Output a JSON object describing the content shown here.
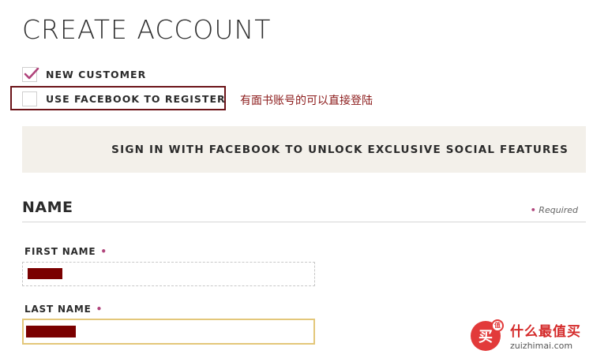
{
  "page_title": "CREATE ACCOUNT",
  "options": {
    "new_customer": {
      "label": "NEW CUSTOMER",
      "checked": true
    },
    "use_facebook": {
      "label": "USE FACEBOOK TO REGISTER",
      "checked": false
    }
  },
  "annotation_text": "有面书账号的可以直接登陆",
  "facebook_banner": "SIGN IN WITH FACEBOOK TO UNLOCK EXCLUSIVE SOCIAL FEATURES",
  "name_section": {
    "title": "NAME",
    "required_marker": "•",
    "required_label": "Required",
    "first_name_label": "FIRST NAME",
    "last_name_label": "LAST NAME"
  },
  "colors": {
    "check_accent": "#b0447b",
    "highlight_border": "#6b1318",
    "annotation": "#8b1a1a",
    "banner_bg": "#f3f0ea",
    "redaction": "#7a0000",
    "focus_border": "#e3c77a"
  },
  "watermark": {
    "logo_char": "买",
    "badge": "值",
    "name": "什么最值买",
    "url": "zuizhimai.com"
  }
}
